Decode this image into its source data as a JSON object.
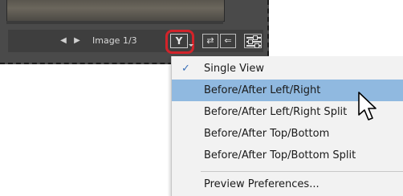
{
  "toolbar": {
    "prev_icon": "◀",
    "next_icon": "▶",
    "image_counter": "Image 1/3",
    "view_mode_icon": "Y",
    "swap_icon": "⇄",
    "copy_icon": "⇐"
  },
  "menu": {
    "check_glyph": "✓",
    "items": [
      {
        "label": "Single View",
        "checked": true
      },
      {
        "label": "Before/After Left/Right",
        "highlighted": true
      },
      {
        "label": "Before/After Left/Right Split"
      },
      {
        "label": "Before/After Top/Bottom"
      },
      {
        "label": "Before/After Top/Bottom Split"
      },
      {
        "label": "Preview Preferences..."
      }
    ]
  },
  "colors": {
    "highlight": "#90b9e0",
    "callout_outline": "#d2232a",
    "panel": "#4a4a4a"
  }
}
